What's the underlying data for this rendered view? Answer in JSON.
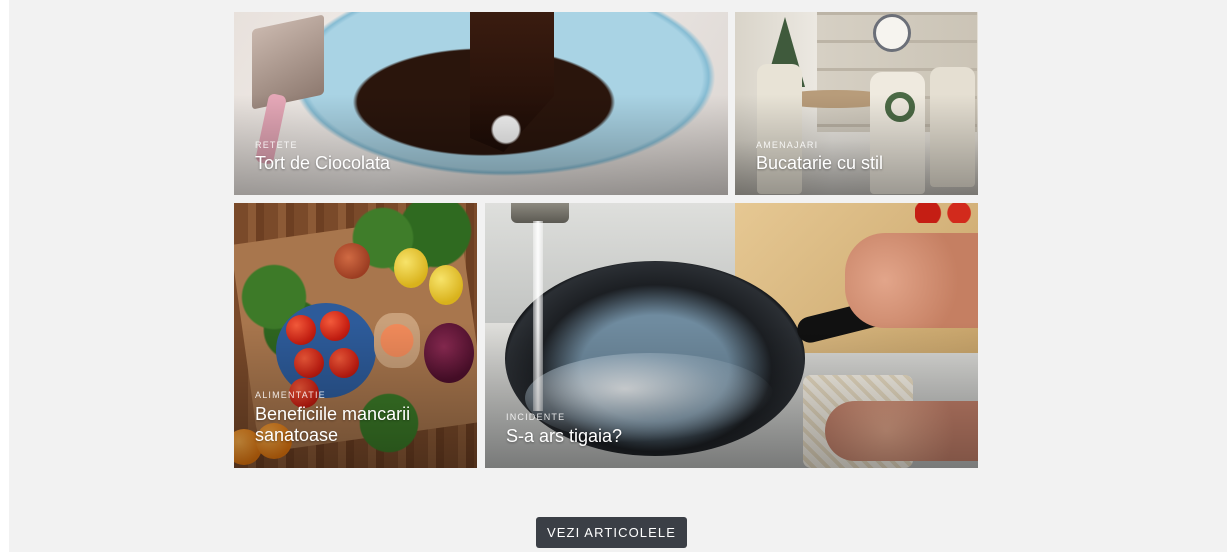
{
  "articles": [
    {
      "category": "Retete",
      "title": "Tort de Ciocolata"
    },
    {
      "category": "Amenajari",
      "title": "Bucatarie cu stil"
    },
    {
      "category": "Alimentatie",
      "title": "Beneficiile mancarii sanatoase"
    },
    {
      "category": "Incidente",
      "title": "S-a ars tigaia?"
    }
  ],
  "cta": {
    "label": "VEZI ARTICOLELE"
  },
  "colors": {
    "background": "#f2f2f2",
    "button": "#3b3f46",
    "button_text": "#ffffff"
  }
}
